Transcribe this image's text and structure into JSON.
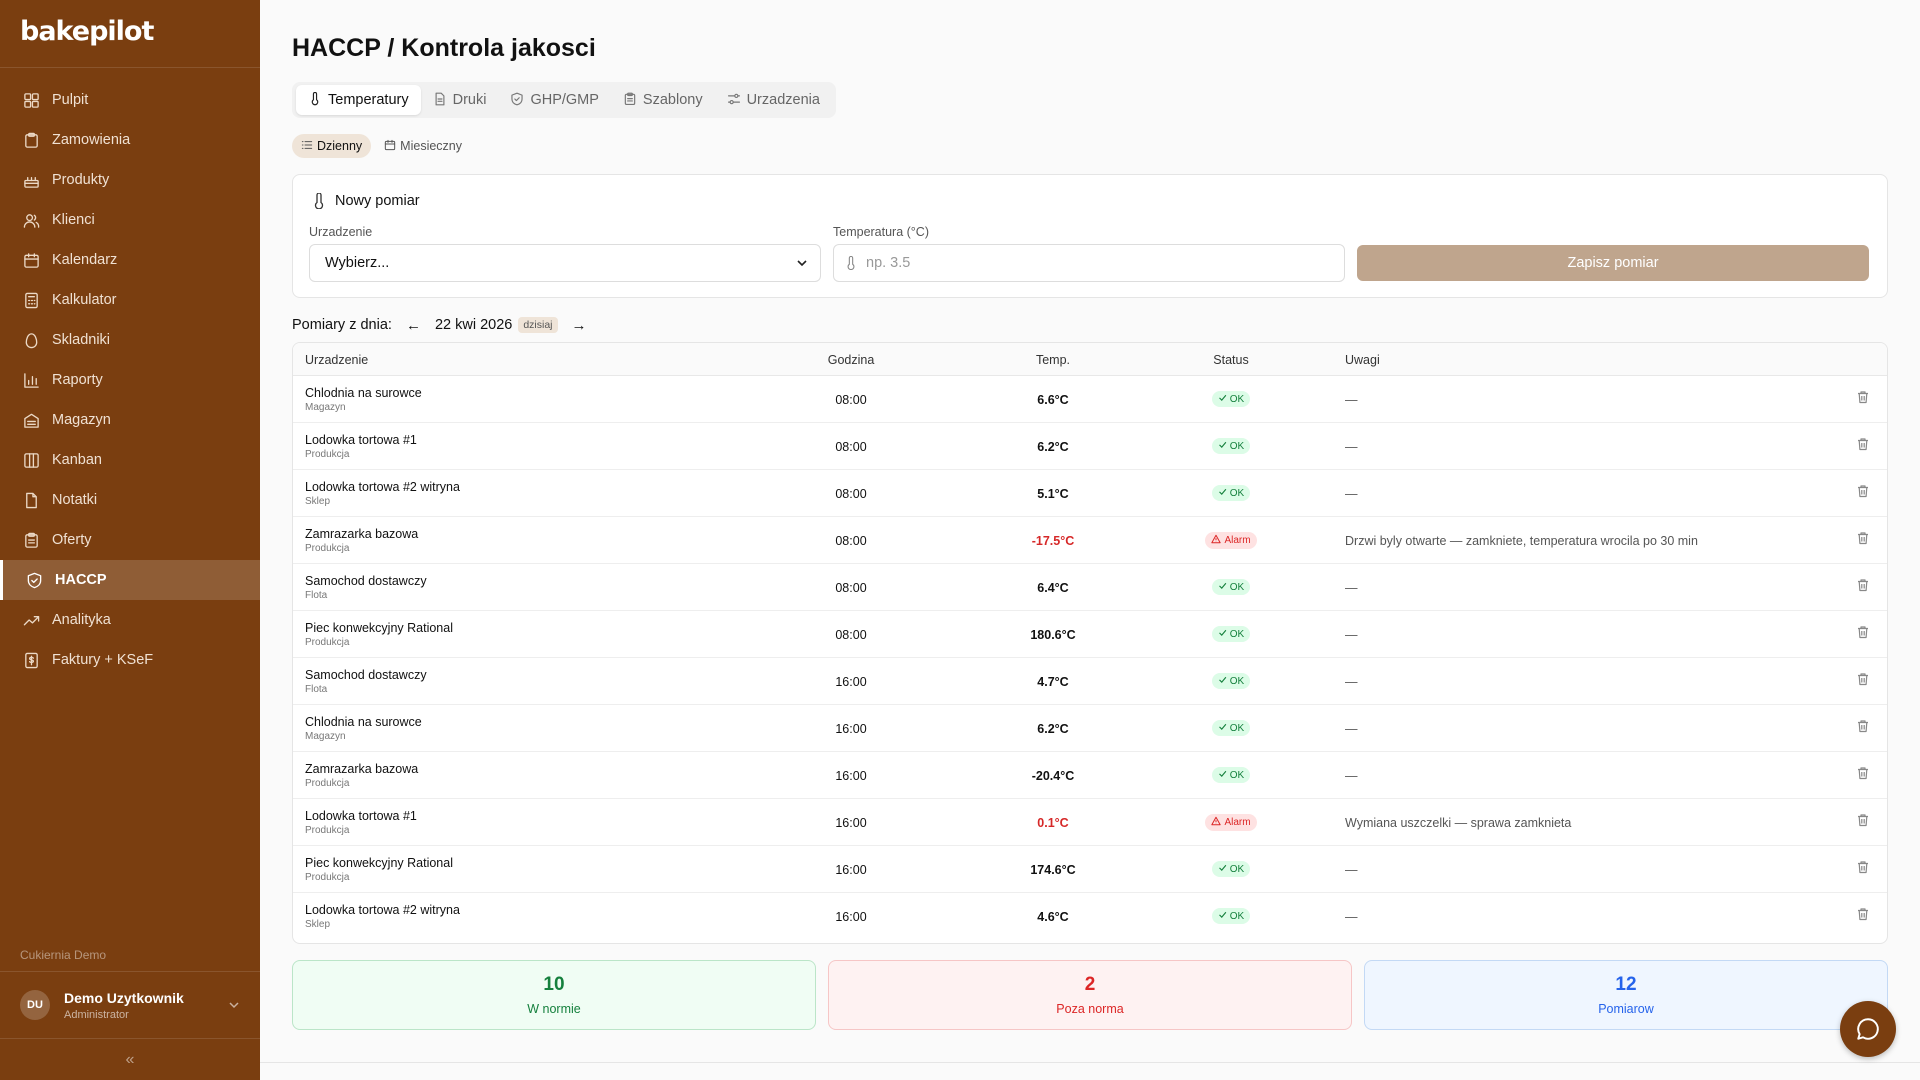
{
  "app": {
    "logo": "bakepilot"
  },
  "sidebar": {
    "items": [
      {
        "label": "Pulpit",
        "icon": "dashboard-icon"
      },
      {
        "label": "Zamowienia",
        "icon": "clipboard-icon"
      },
      {
        "label": "Produkty",
        "icon": "cake-icon"
      },
      {
        "label": "Klienci",
        "icon": "users-icon"
      },
      {
        "label": "Kalendarz",
        "icon": "calendar-icon"
      },
      {
        "label": "Kalkulator",
        "icon": "calculator-icon"
      },
      {
        "label": "Skladniki",
        "icon": "egg-icon"
      },
      {
        "label": "Raporty",
        "icon": "bar-chart-icon"
      },
      {
        "label": "Magazyn",
        "icon": "warehouse-icon"
      },
      {
        "label": "Kanban",
        "icon": "kanban-icon"
      },
      {
        "label": "Notatki",
        "icon": "file-icon"
      },
      {
        "label": "Oferty",
        "icon": "clipboard-list-icon"
      },
      {
        "label": "HACCP",
        "icon": "shield-icon",
        "active": true
      },
      {
        "label": "Analityka",
        "icon": "trend-icon"
      },
      {
        "label": "Faktury + KSeF",
        "icon": "invoice-icon"
      }
    ],
    "org_name": "Cukiernia Demo",
    "user": {
      "initials": "DU",
      "name": "Demo Uzytkownik",
      "role": "Administrator"
    }
  },
  "page": {
    "title": "HACCP / Kontrola jakosci"
  },
  "tabs": [
    {
      "label": "Temperatury",
      "icon": "thermometer-icon",
      "active": true
    },
    {
      "label": "Druki",
      "icon": "document-icon"
    },
    {
      "label": "GHP/GMP",
      "icon": "shield-check-icon"
    },
    {
      "label": "Szablony",
      "icon": "clipboard-icon"
    },
    {
      "label": "Urzadzenia",
      "icon": "sliders-icon"
    }
  ],
  "subtabs": [
    {
      "label": "Dzienny",
      "icon": "list-icon",
      "active": true
    },
    {
      "label": "Miesieczny",
      "icon": "calendar-icon"
    }
  ],
  "form": {
    "title": "Nowy pomiar",
    "device_label": "Urzadzenie",
    "device_value": "Wybierz...",
    "temp_label": "Temperatura (°C)",
    "temp_placeholder": "np. 3.5",
    "save_label": "Zapisz pomiar"
  },
  "date_nav": {
    "label": "Pomiary z dnia:",
    "prev": "←",
    "date": "22 kwi 2026",
    "today": "dzisiaj",
    "next": "→"
  },
  "table": {
    "headers": {
      "device": "Urzadzenie",
      "time": "Godzina",
      "temp": "Temp.",
      "status": "Status",
      "notes": "Uwagi"
    },
    "rows": [
      {
        "device": "Chlodnia na surowce",
        "location": "Magazyn",
        "time": "08:00",
        "temp": "6.6°C",
        "status": "OK",
        "alarm": false,
        "notes": "—"
      },
      {
        "device": "Lodowka tortowa #1",
        "location": "Produkcja",
        "time": "08:00",
        "temp": "6.2°C",
        "status": "OK",
        "alarm": false,
        "notes": "—"
      },
      {
        "device": "Lodowka tortowa #2 witryna",
        "location": "Sklep",
        "time": "08:00",
        "temp": "5.1°C",
        "status": "OK",
        "alarm": false,
        "notes": "—"
      },
      {
        "device": "Zamrazarka bazowa",
        "location": "Produkcja",
        "time": "08:00",
        "temp": "-17.5°C",
        "status": "Alarm",
        "alarm": true,
        "notes": "Drzwi byly otwarte — zamkniete, temperatura wrocila po 30 min"
      },
      {
        "device": "Samochod dostawczy",
        "location": "Flota",
        "time": "08:00",
        "temp": "6.4°C",
        "status": "OK",
        "alarm": false,
        "notes": "—"
      },
      {
        "device": "Piec konwekcyjny Rational",
        "location": "Produkcja",
        "time": "08:00",
        "temp": "180.6°C",
        "status": "OK",
        "alarm": false,
        "notes": "—"
      },
      {
        "device": "Samochod dostawczy",
        "location": "Flota",
        "time": "16:00",
        "temp": "4.7°C",
        "status": "OK",
        "alarm": false,
        "notes": "—"
      },
      {
        "device": "Chlodnia na surowce",
        "location": "Magazyn",
        "time": "16:00",
        "temp": "6.2°C",
        "status": "OK",
        "alarm": false,
        "notes": "—"
      },
      {
        "device": "Zamrazarka bazowa",
        "location": "Produkcja",
        "time": "16:00",
        "temp": "-20.4°C",
        "status": "OK",
        "alarm": false,
        "notes": "—"
      },
      {
        "device": "Lodowka tortowa #1",
        "location": "Produkcja",
        "time": "16:00",
        "temp": "0.1°C",
        "status": "Alarm",
        "alarm": true,
        "notes": "Wymiana uszczelki — sprawa zamknieta"
      },
      {
        "device": "Piec konwekcyjny Rational",
        "location": "Produkcja",
        "time": "16:00",
        "temp": "174.6°C",
        "status": "OK",
        "alarm": false,
        "notes": "—"
      },
      {
        "device": "Lodowka tortowa #2 witryna",
        "location": "Sklep",
        "time": "16:00",
        "temp": "4.6°C",
        "status": "OK",
        "alarm": false,
        "notes": "—"
      }
    ]
  },
  "stats": [
    {
      "value": "10",
      "label": "W normie",
      "color": "#15803d"
    },
    {
      "value": "2",
      "label": "Poza norma",
      "color": "#dc2626"
    },
    {
      "value": "12",
      "label": "Pomiarow",
      "color": "#2563eb"
    }
  ],
  "colors": {
    "sidebar": "#7a3e10",
    "accent_button": "#bfa58d",
    "ok": "#15803d",
    "alarm": "#dc2626"
  }
}
